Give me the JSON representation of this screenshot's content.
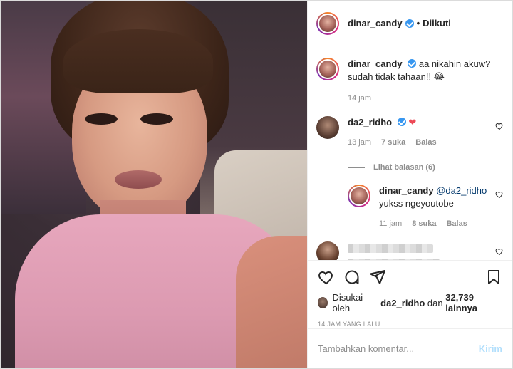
{
  "post": {
    "author": "dinar_candy",
    "follow_status": "Diikuti",
    "dot": "•",
    "caption_line1": "aa nikahin akuw?",
    "caption_line2": "sudah tidak tahaan!! 😂",
    "caption_time": "14 jam"
  },
  "comments": [
    {
      "user": "da2_ridho",
      "text": "❤",
      "time": "13 jam",
      "likes": "7 suka",
      "reply_label": "Balas",
      "view_replies": "Lihat balasan (6)"
    }
  ],
  "reply": {
    "user": "dinar_candy",
    "mention": "@da2_ridho",
    "text": "yukss ngeyoutobe",
    "time": "11 jam",
    "likes": "8 suka",
    "reply_label": "Balas"
  },
  "liked_by": {
    "prefix": "Disukai oleh",
    "user": "da2_ridho",
    "and": "dan",
    "others": "32,739 lainnya"
  },
  "post_time": "14 JAM YANG LALU",
  "comment_box": {
    "placeholder": "Tambahkan komentar...",
    "post_label": "Kirim"
  },
  "colors": {
    "verified": "#3897f0",
    "heart": "#ed4956",
    "post_button_disabled": "#b2dffc"
  },
  "icons": [
    "heart-icon",
    "comment-icon",
    "share-icon",
    "bookmark-icon",
    "verified-icon"
  ]
}
